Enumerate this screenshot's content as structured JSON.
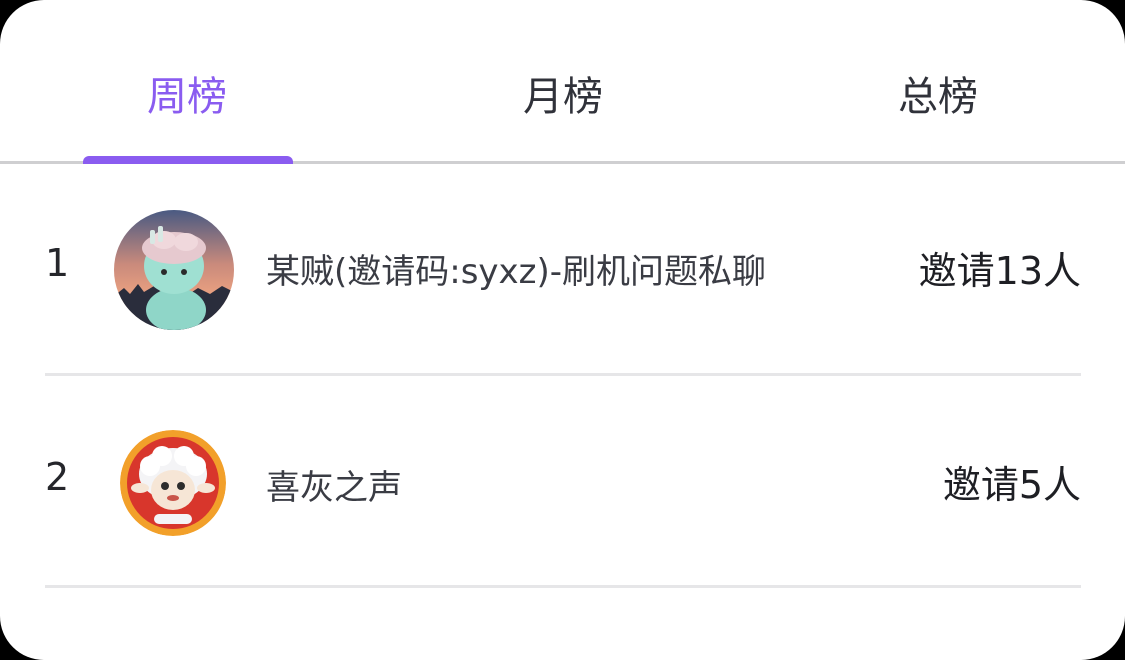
{
  "tabs": [
    {
      "label": "周榜",
      "active": true
    },
    {
      "label": "月榜",
      "active": false
    },
    {
      "label": "总榜",
      "active": false
    }
  ],
  "colors": {
    "accent": "#8a5cf0",
    "text_primary": "#1e1f24",
    "divider": "#e6e6e8"
  },
  "rankings": [
    {
      "rank": "1",
      "avatar": "doll-figure-sunset-avatar",
      "name": "某贼(邀请码:syxz)-刷机问题私聊",
      "invite": "邀请13人"
    },
    {
      "rank": "2",
      "avatar": "cartoon-sheep-avatar",
      "name": "喜灰之声",
      "invite": "邀请5人"
    }
  ]
}
